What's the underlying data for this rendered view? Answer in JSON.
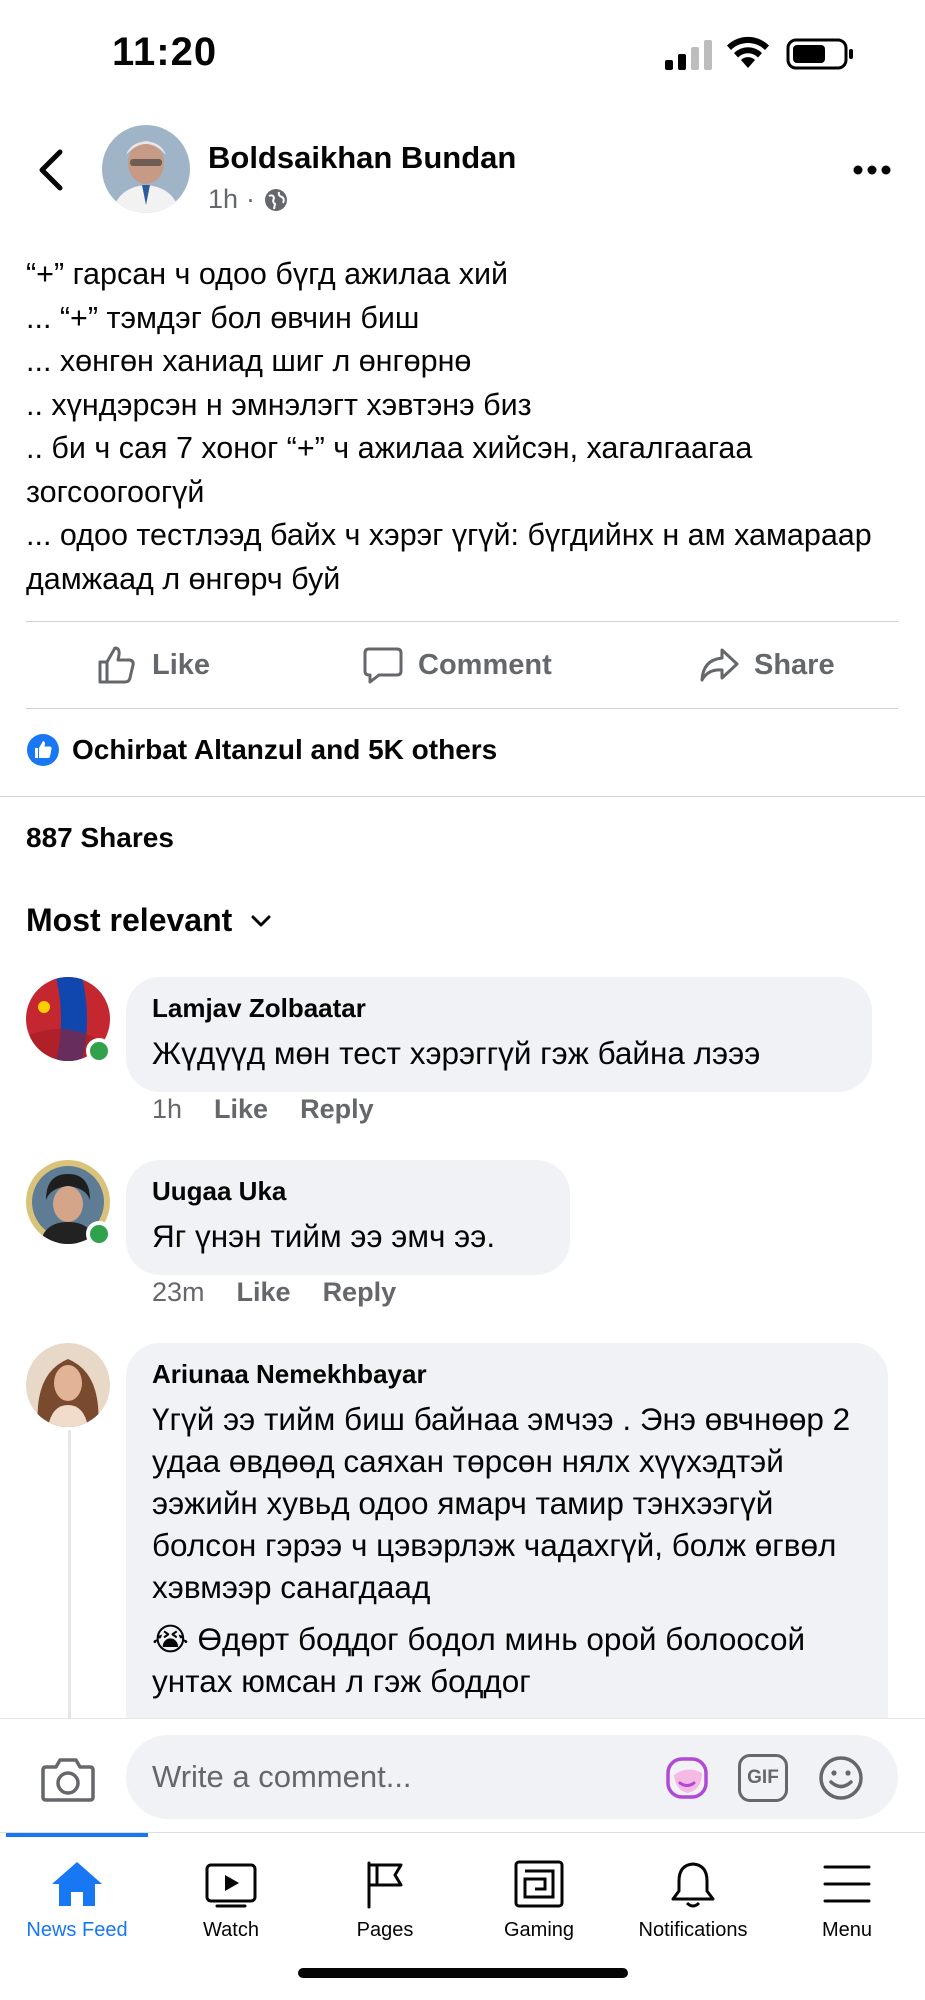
{
  "status_bar": {
    "time": "11:20"
  },
  "post": {
    "author": "Boldsaikhan Bundan",
    "time": "1h",
    "separator": "·",
    "text": "“+” гарсан ч одоо бүгд ажилаа хий\n... “+” тэмдэг бол өвчин биш\n... хөнгөн ханиад шиг л өнгөрнө\n .. хүндэрсэн н эмнэлэгт хэвтэнэ биз\n.. би ч сая 7 хоног “+” ч ажилаа хийсэн, хагалгаагаа зогсоогоогүй\n... одоо тестлээд байх ч хэрэг үгүй: бүгдийнх н ам хамараар дамжаад л өнгөрч буй"
  },
  "actions": {
    "like": "Like",
    "comment": "Comment",
    "share": "Share"
  },
  "reactions_text": "Ochirbat Altanzul and 5K others",
  "shares_text": "887 Shares",
  "sort_label": "Most relevant",
  "comments": [
    {
      "name": "Lamjav Zolbaatar",
      "text": "Жүдүүд мөн тест хэрэггүй гэж байна лэээ",
      "time": "1h",
      "like": "Like",
      "reply": "Reply"
    },
    {
      "name": "Uugaa Uka",
      "text": "Яг үнэн тийм ээ эмч ээ.",
      "time": "23m",
      "like": "Like",
      "reply": "Reply"
    },
    {
      "name": "Ariunaa Nemekhbayar",
      "text": "Үгүй ээ тийм биш байнаа эмчээ . Энэ өвчнөөр 2 удаа өвдөөд саяхан төрсөн нялх хүүхэдтэй ээжийн хувьд одоо ямарч тамир тэнхээгүй болсон гэрээ ч цэвэрлэж чадахгүй, болж өгвөл хэвмээр санагдаад",
      "text2": "😭 Өдөрт боддог бодол минь орой болоосой унтах юмсан л гэж боддог"
    }
  ],
  "composer": {
    "placeholder": "Write a comment...",
    "gif": "GIF"
  },
  "nav": [
    {
      "label": "News Feed",
      "icon": "home-icon",
      "active": true
    },
    {
      "label": "Watch",
      "icon": "watch-icon"
    },
    {
      "label": "Pages",
      "icon": "flag-icon"
    },
    {
      "label": "Gaming",
      "icon": "gaming-icon"
    },
    {
      "label": "Notifications",
      "icon": "bell-icon"
    },
    {
      "label": "Menu",
      "icon": "menu-icon"
    }
  ],
  "colors": {
    "accent": "#1877f2",
    "secondary_text": "#65676b",
    "bubble": "#f0f2f5",
    "online": "#31a24c"
  }
}
